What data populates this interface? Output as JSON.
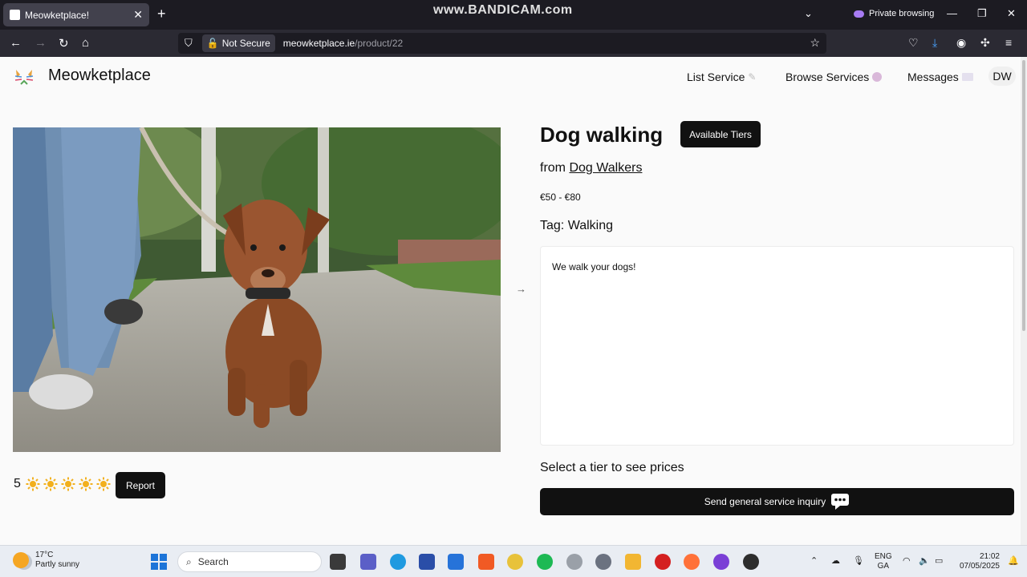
{
  "browser": {
    "tab_title": "Meowketplace!",
    "watermark": "www.BANDICAM.com",
    "private_label": "Private browsing",
    "security_label": "Not Secure",
    "url_host": "meowketplace.ie",
    "url_path": "/product/22"
  },
  "site": {
    "brand": "Meowketplace",
    "nav": {
      "list_service": "List Service",
      "browse_services": "Browse Services",
      "messages": "Messages"
    },
    "user_initials": "DW"
  },
  "product": {
    "title": "Dog walking",
    "tiers_button": "Available Tiers",
    "from_prefix": "from",
    "provider": "Dog Walkers",
    "price_range": "€50 - €80",
    "tag": "Tag: Walking",
    "description": "We walk your dogs!",
    "select_tier_text": "Select a tier to see prices",
    "inquiry_button": "Send general service inquiry",
    "rating": "5",
    "rating_stars": 5,
    "report_button": "Report"
  },
  "taskbar": {
    "weather_temp": "17°C",
    "weather_desc": "Partly sunny",
    "search_placeholder": "Search",
    "lang_1": "ENG",
    "lang_2": "GA",
    "time": "21:02",
    "date": "07/05/2025"
  },
  "colors": {
    "button_bg": "#111111",
    "chrome_dark": "#1c1b22",
    "private_accent": "#a77bf3"
  }
}
